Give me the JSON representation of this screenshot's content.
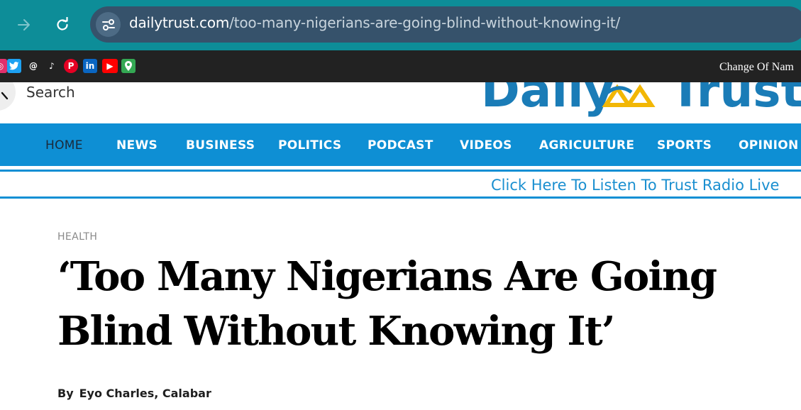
{
  "browser": {
    "url_domain": "dailytrust.com",
    "url_path": "/too-many-nigerians-are-going-blind-without-knowing-it/",
    "forward_icon": "arrow-right-icon",
    "reload_icon": "reload-icon",
    "site_info_icon": "tune-icon"
  },
  "topbar": {
    "social_icons": [
      "instagram-icon",
      "twitter-icon",
      "threads-icon",
      "tiktok-icon",
      "pinterest-icon",
      "linkedin-icon",
      "youtube-icon",
      "location-icon"
    ],
    "ticker_text": "Change Of Nam"
  },
  "header": {
    "search_label": "Search",
    "logo_text_left": "Daily",
    "logo_text_right": "Trust",
    "logo_colors": {
      "text": "#1a7cb7",
      "emblem": "#f2b705"
    }
  },
  "nav": {
    "items": [
      "HOME",
      "NEWS",
      "BUSINESS",
      "POLITICS",
      "PODCAST",
      "VIDEOS",
      "AGRICULTURE",
      "SPORTS",
      "OPINION"
    ],
    "active": "HOME",
    "color": "#0e8fd4"
  },
  "radio": {
    "label": "Click Here To Listen To Trust Radio Live"
  },
  "article": {
    "category": "HEALTH",
    "headline_line1": "‘Too Many Nigerians Are Going",
    "headline_line2": "Blind Without Knowing It’",
    "byline_prefix": "By",
    "byline_author": "Eyo Charles, Calabar"
  }
}
